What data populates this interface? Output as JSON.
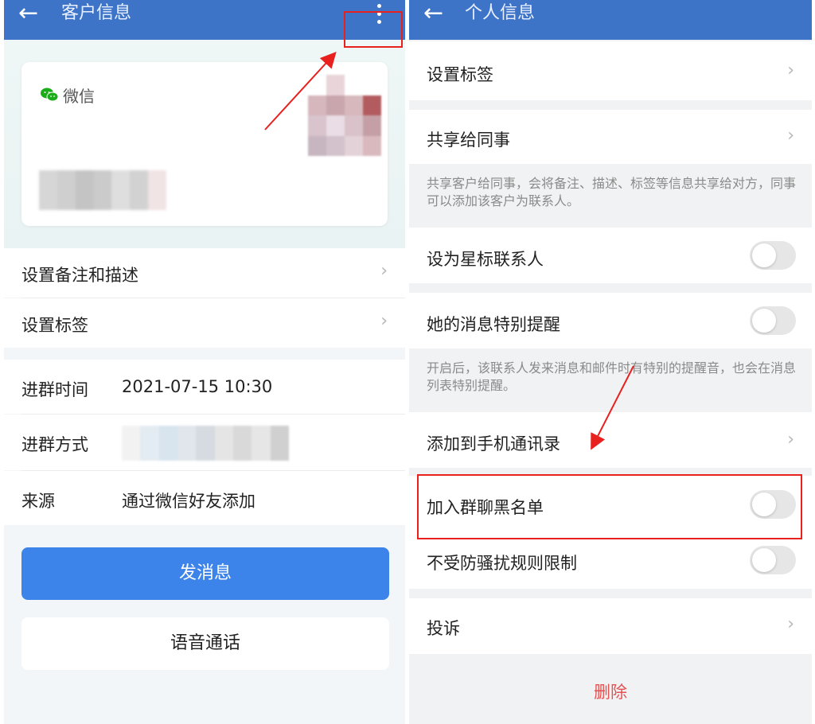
{
  "left": {
    "header": {
      "title": "客户信息",
      "back_icon": "arrow-left-icon",
      "more_icon": "more-vertical-icon"
    },
    "card": {
      "wechat_label": "微信",
      "wechat_color": "#1aad19"
    },
    "settings": [
      {
        "label": "设置备注和描述"
      },
      {
        "label": "设置标签"
      }
    ],
    "info": [
      {
        "label": "进群时间",
        "value": "2021-07-15 10:30"
      },
      {
        "label": "进群方式",
        "value": ""
      },
      {
        "label": "来源",
        "value": "通过微信好友添加"
      }
    ],
    "buttons": {
      "send_message": "发消息",
      "voice_call": "语音通话"
    },
    "colors": {
      "header": "#3e74c7",
      "primary_button": "#3d84ea"
    }
  },
  "right": {
    "header": {
      "title": "个人信息",
      "back_icon": "arrow-left-icon"
    },
    "set_tags": "设置标签",
    "share": {
      "label": "共享给同事",
      "note": "共享客户给同事，会将备注、描述、标签等信息共享给对方，同事可以添加该客户为联系人。"
    },
    "star_contact": {
      "label": "设为星标联系人",
      "on": false
    },
    "special_reminder": {
      "label": "她的消息特别提醒",
      "on": false,
      "note": "开启后，该联系人发来消息和邮件时有特别的提醒音，也会在消息列表特别提醒。"
    },
    "add_to_contacts": "添加到手机通讯录",
    "group_blacklist": {
      "label": "加入群聊黑名单",
      "on": false
    },
    "no_harassment_rule": {
      "label": "不受防骚扰规则限制",
      "on": false
    },
    "complain": "投诉",
    "delete": "删除",
    "colors": {
      "delete": "#e55151",
      "annotation": "#e8211e"
    }
  }
}
